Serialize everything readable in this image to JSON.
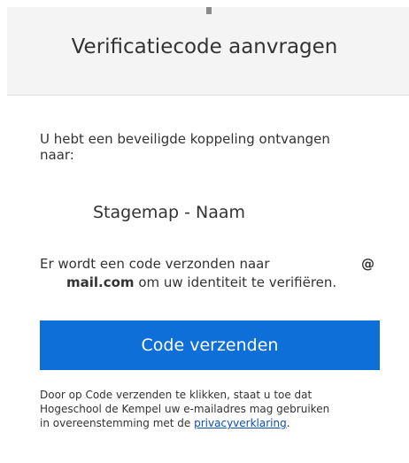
{
  "header": {
    "title": "Verificatiecode aanvragen"
  },
  "main": {
    "intro": "U hebt een beveiligde koppeling ontvangen naar:",
    "document_name": "Stagemap - Naam",
    "notice_prefix": "Er wordt een code verzonden naar",
    "notice_at": "@",
    "notice_email_domain": "mail.com",
    "notice_suffix": " om uw identiteit te verifiëren.",
    "send_button_label": "Code verzenden"
  },
  "footer": {
    "line1": "Door op Code verzenden te klikken, staat u toe dat",
    "line2": "Hogeschool de Kempel uw e-mailadres mag gebruiken",
    "line3_prefix": "in overeenstemming met de ",
    "privacy_link": "privacyverklaring",
    "line3_suffix": "."
  },
  "colors": {
    "button_bg": "#0f6fd8",
    "header_bg": "#f4f4f4",
    "link": "#0b4fb3"
  }
}
